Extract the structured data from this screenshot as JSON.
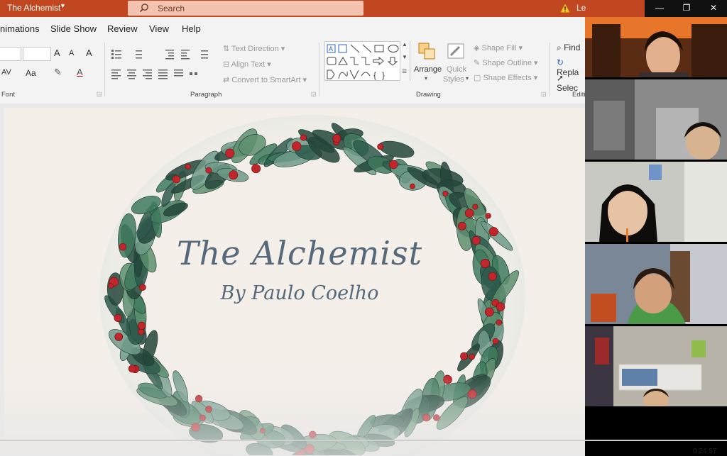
{
  "window": {
    "title": "The Alchemist",
    "search_placeholder": "Search",
    "user_partial": "Le",
    "controls": [
      "—",
      "❐",
      "✕"
    ]
  },
  "ribbon": {
    "tabs": [
      "nimations",
      "Slide Show",
      "Review",
      "View",
      "Help"
    ],
    "font": {
      "label": "Font",
      "grow": "A",
      "shrink": "A",
      "clear": "A",
      "effects": "AV",
      "case": "Aa"
    },
    "paragraph": {
      "label": "Paragraph",
      "text_direction": "Text Direction",
      "align_text": "Align Text",
      "convert_smartart": "Convert to SmartArt"
    },
    "drawing": {
      "label": "Drawing",
      "arrange": "Arrange",
      "quick": "Quick",
      "styles": "Styles",
      "shape_fill": "Shape Fill",
      "shape_outline": "Shape Outline",
      "shape_effects": "Shape Effects"
    },
    "editing": {
      "label": "Editi",
      "find": "Find",
      "replace": "Repla",
      "select": "Selec"
    }
  },
  "slide": {
    "title": "The Alchemist",
    "subtitle": "By Paulo Coelho"
  },
  "video": {
    "timestamp": "0:24:57",
    "tiles": 5
  },
  "colors": {
    "titlebar": "#c0471f",
    "ribbon": "#f3f3f3",
    "slide_bg": "#f5efea",
    "title_text": "#56697a",
    "leaf_dark": "#2e5a4c",
    "berry": "#c0262c"
  }
}
